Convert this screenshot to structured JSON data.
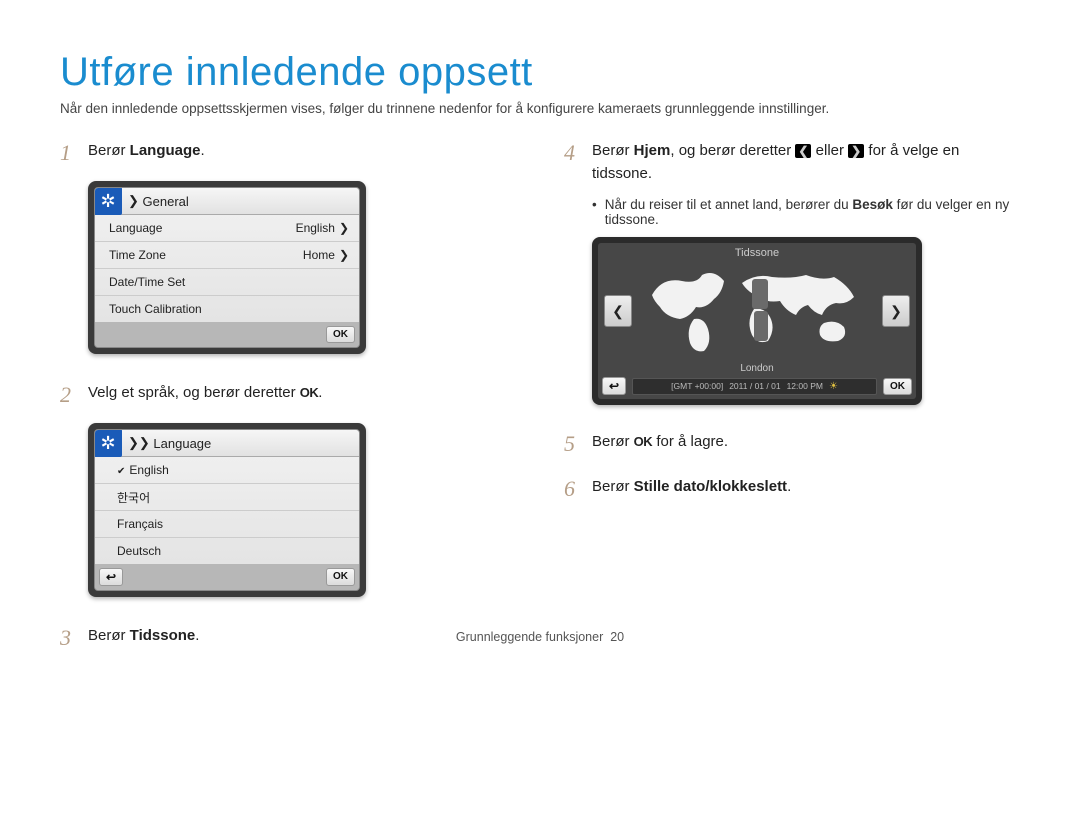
{
  "title": "Utføre innledende oppsett",
  "intro": "Når den innledende oppsettsskjermen vises, følger du trinnene nedenfor for å konfigurere kameraets grunnleggende innstillinger.",
  "footer": {
    "section": "Grunnleggende funksjoner",
    "page": "20"
  },
  "glyphs": {
    "ok": "OK",
    "left": "❮",
    "right": "❯"
  },
  "steps": {
    "s1": {
      "num": "1",
      "pre": "Berør ",
      "strong": "Language",
      "post": "."
    },
    "s2": {
      "num": "2",
      "pre": "Velg et språk, og berør deretter ",
      "post": "."
    },
    "s3": {
      "num": "3",
      "pre": "Berør ",
      "strong": "Tidssone",
      "post": "."
    },
    "s4": {
      "num": "4",
      "pre": "Berør ",
      "strong": "Hjem",
      "mid1": ", og berør deretter ",
      "mid2": " eller ",
      "post": " for å velge en tidssone."
    },
    "s4_bullet": {
      "a": "Når du reiser til et annet land, berører du ",
      "b": "Besøk",
      "c": " før du velger en ny tidssone."
    },
    "s5": {
      "num": "5",
      "pre": "Berør ",
      "post": " for å lagre."
    },
    "s6": {
      "num": "6",
      "pre": "Berør ",
      "strong": "Stille dato/klokkeslett",
      "post": "."
    }
  },
  "screen_general": {
    "header_arrow": "❯",
    "header": "General",
    "rows": [
      {
        "label": "Language",
        "value": "English",
        "chev": "❯"
      },
      {
        "label": "Time Zone",
        "value": "Home",
        "chev": "❯"
      },
      {
        "label": "Date/Time Set",
        "value": "",
        "chev": ""
      },
      {
        "label": "Touch Calibration",
        "value": "",
        "chev": ""
      }
    ],
    "ok": "OK"
  },
  "screen_language": {
    "header_arrow": "❯❯",
    "header": "Language",
    "items": [
      "English",
      "한국어",
      "Français",
      "Deutsch"
    ],
    "selected_index": 0,
    "back": "↩",
    "ok": "OK"
  },
  "screen_timezone": {
    "title": "Tidssone",
    "left": "❮",
    "right": "❯",
    "city": "London",
    "gmt": "[GMT +00:00]",
    "date": "2011 / 01 / 01",
    "time": "12:00 PM",
    "back": "↩",
    "ok": "OK"
  }
}
